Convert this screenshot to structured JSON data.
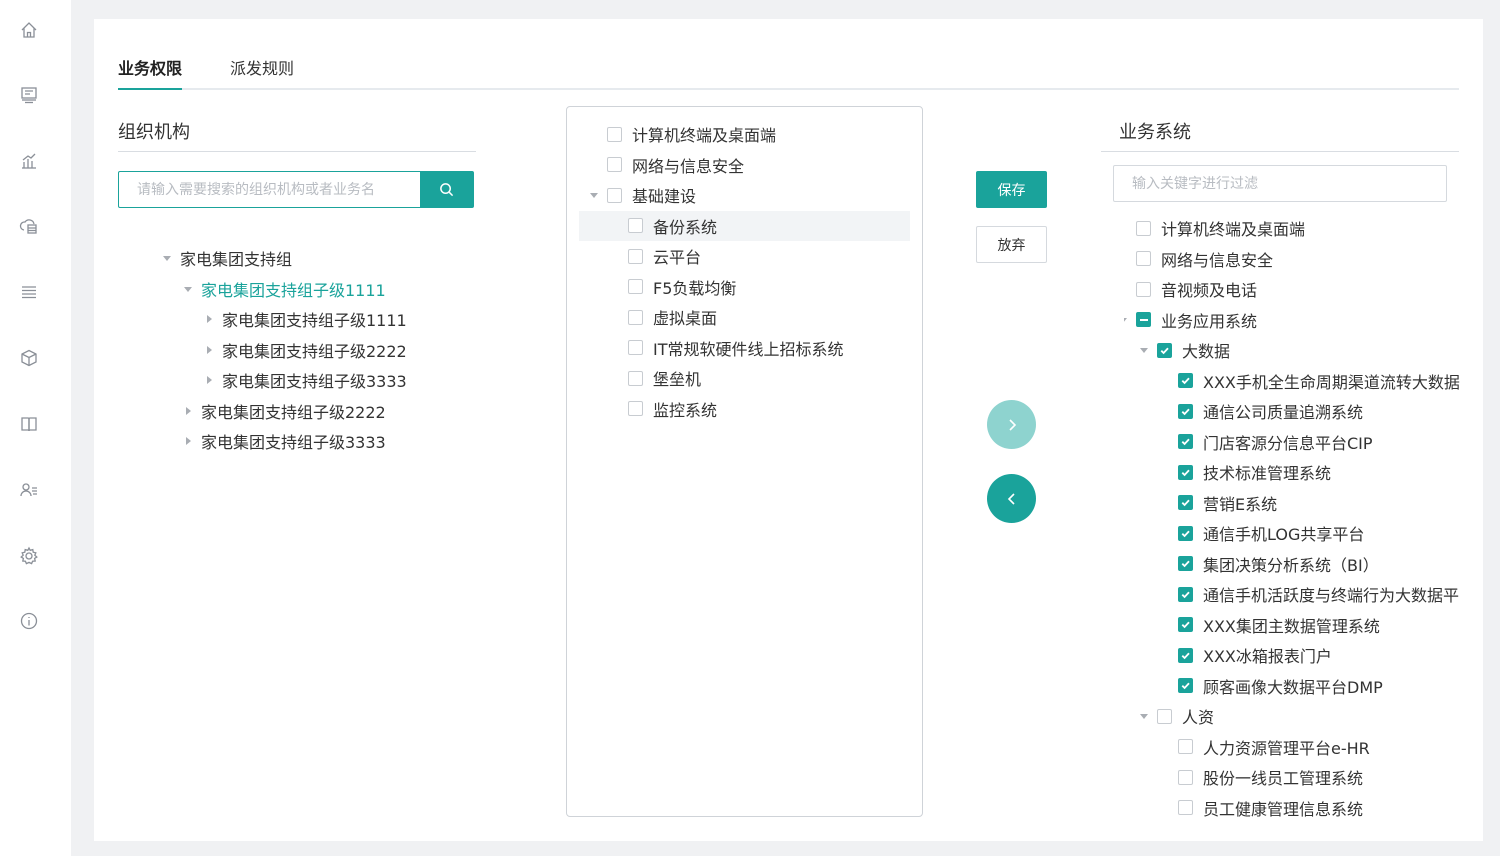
{
  "sidebar": {
    "icons": [
      "home-icon",
      "monitor-icon",
      "chart-icon",
      "cloud-server-icon",
      "list-icon",
      "cube-icon",
      "book-icon",
      "users-icon",
      "gear-icon",
      "info-icon"
    ]
  },
  "tabs": [
    {
      "label": "业务权限",
      "active": true
    },
    {
      "label": "派发规则",
      "active": false
    }
  ],
  "org": {
    "title": "组织机构",
    "search_placeholder": "请输入需要搜索的组织机构或者业务名",
    "tree": [
      {
        "label": "家电集团支持组",
        "level": 0,
        "caret": "down",
        "selected": false
      },
      {
        "label": "家电集团支持组子级1111",
        "level": 1,
        "caret": "down",
        "selected": true
      },
      {
        "label": "家电集团支持组子级1111",
        "level": 2,
        "caret": "right",
        "selected": false
      },
      {
        "label": "家电集团支持组子级2222",
        "level": 2,
        "caret": "right",
        "selected": false
      },
      {
        "label": "家电集团支持组子级3333",
        "level": 2,
        "caret": "right",
        "selected": false
      },
      {
        "label": "家电集团支持组子级2222",
        "level": 1,
        "caret": "right",
        "selected": false
      },
      {
        "label": "家电集团支持组子级3333",
        "level": 1,
        "caret": "right",
        "selected": false
      }
    ]
  },
  "middle": {
    "items": [
      {
        "label": "计算机终端及桌面端",
        "level": 0,
        "caret": "none",
        "state": "unchecked"
      },
      {
        "label": "网络与信息安全",
        "level": 0,
        "caret": "none",
        "state": "unchecked"
      },
      {
        "label": "基础建设",
        "level": 0,
        "caret": "down",
        "state": "unchecked"
      },
      {
        "label": "备份系统",
        "level": 1,
        "caret": "none",
        "state": "unchecked",
        "highlight": true
      },
      {
        "label": "云平台",
        "level": 1,
        "caret": "none",
        "state": "unchecked"
      },
      {
        "label": "F5负载均衡",
        "level": 1,
        "caret": "none",
        "state": "unchecked"
      },
      {
        "label": "虚拟桌面",
        "level": 1,
        "caret": "none",
        "state": "unchecked"
      },
      {
        "label": "IT常规软硬件线上招标系统",
        "level": 1,
        "caret": "none",
        "state": "unchecked"
      },
      {
        "label": "堡垒机",
        "level": 1,
        "caret": "none",
        "state": "unchecked"
      },
      {
        "label": "监控系统",
        "level": 1,
        "caret": "none",
        "state": "unchecked"
      }
    ]
  },
  "actions": {
    "save_label": "保存",
    "cancel_label": "放弃"
  },
  "business": {
    "title": "业务系统",
    "filter_placeholder": "输入关键字进行过滤",
    "items": [
      {
        "label": "计算机终端及桌面端",
        "level": 0,
        "caret": "none",
        "state": "unchecked"
      },
      {
        "label": "网络与信息安全",
        "level": 0,
        "caret": "none",
        "state": "unchecked"
      },
      {
        "label": "音视频及电话",
        "level": 0,
        "caret": "none",
        "state": "unchecked"
      },
      {
        "label": "业务应用系统",
        "level": 0,
        "caret": "down",
        "state": "partial"
      },
      {
        "label": "大数据",
        "level": 1,
        "caret": "down",
        "state": "checked"
      },
      {
        "label": "XXX手机全生命周期渠道流转大数据",
        "level": 2,
        "caret": "none",
        "state": "checked"
      },
      {
        "label": "通信公司质量追溯系统",
        "level": 2,
        "caret": "none",
        "state": "checked"
      },
      {
        "label": "门店客源分信息平台CIP",
        "level": 2,
        "caret": "none",
        "state": "checked"
      },
      {
        "label": "技术标准管理系统",
        "level": 2,
        "caret": "none",
        "state": "checked"
      },
      {
        "label": "营销E系统",
        "level": 2,
        "caret": "none",
        "state": "checked"
      },
      {
        "label": "通信手机LOG共享平台",
        "level": 2,
        "caret": "none",
        "state": "checked"
      },
      {
        "label": "集团决策分析系统（BI）",
        "level": 2,
        "caret": "none",
        "state": "checked"
      },
      {
        "label": "通信手机活跃度与终端行为大数据平台",
        "level": 2,
        "caret": "none",
        "state": "checked"
      },
      {
        "label": "XXX集团主数据管理系统",
        "level": 2,
        "caret": "none",
        "state": "checked"
      },
      {
        "label": "XXX冰箱报表门户",
        "level": 2,
        "caret": "none",
        "state": "checked"
      },
      {
        "label": "顾客画像大数据平台DMP",
        "level": 2,
        "caret": "none",
        "state": "checked"
      },
      {
        "label": "人资",
        "level": 1,
        "caret": "down",
        "state": "unchecked"
      },
      {
        "label": "人力资源管理平台e-HR",
        "level": 2,
        "caret": "none",
        "state": "unchecked"
      },
      {
        "label": "股份一线员工管理系统",
        "level": 2,
        "caret": "none",
        "state": "unchecked"
      },
      {
        "label": "员工健康管理信息系统",
        "level": 2,
        "caret": "none",
        "state": "unchecked"
      }
    ]
  },
  "colors": {
    "accent": "#1aa39b",
    "accent_light": "#8ed3cf",
    "background": "#f0f1f3"
  }
}
